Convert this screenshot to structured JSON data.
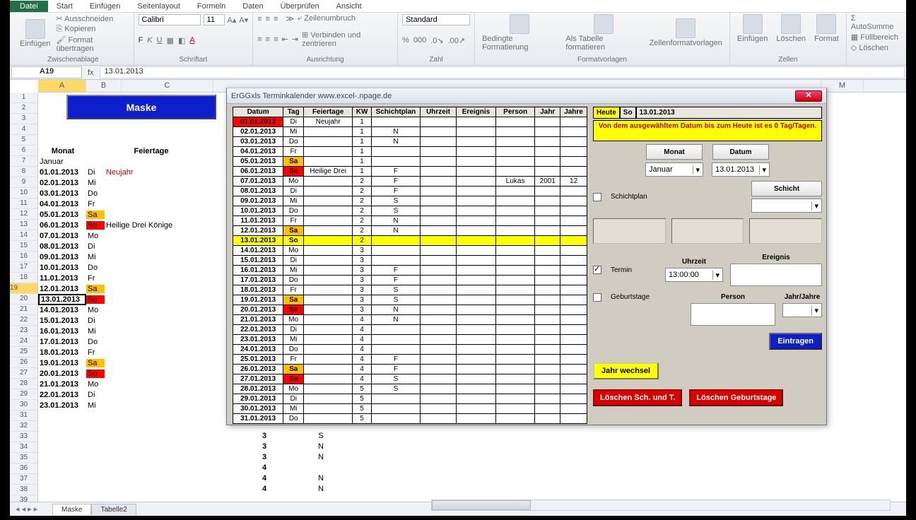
{
  "menu": {
    "file": "Datei",
    "items": [
      "Start",
      "Einfügen",
      "Seitenlayout",
      "Formeln",
      "Daten",
      "Überprüfen",
      "Ansicht"
    ]
  },
  "ribbon": {
    "clipboard": {
      "paste": "Einfügen",
      "cut": "Ausschneiden",
      "copy": "Kopieren",
      "fmt": "Format übertragen",
      "label": "Zwischenablage"
    },
    "font": {
      "name": "Calibri",
      "size": "11",
      "label": "Schriftart"
    },
    "align": {
      "wrap": "Zeilenumbruch",
      "merge": "Verbinden und zentrieren",
      "label": "Ausrichtung"
    },
    "number": {
      "fmt": "Standard",
      "label": "Zahl"
    },
    "styles": {
      "cond": "Bedingte Formatierung",
      "table": "Als Tabelle formatieren",
      "cell": "Zellenformatvorlagen",
      "label": "Formatvorlagen"
    },
    "cells": {
      "ins": "Einfügen",
      "del": "Löschen",
      "fmt": "Format",
      "label": "Zellen"
    },
    "edit": {
      "sum": "AutoSumme",
      "fill": "Füllbereich",
      "clear": "Löschen"
    }
  },
  "namebox": "A19",
  "formula": "13.01.2013",
  "cols": [
    "A",
    "B",
    "C",
    "M"
  ],
  "maske": "Maske",
  "sheet_hdr": {
    "monat": "Monat",
    "feiertage": "Feiertage"
  },
  "month": "Januar",
  "rows": [
    {
      "n": 7,
      "d": "01.01.2013",
      "w": "Di",
      "f": "Neujahr",
      "cls": "nj"
    },
    {
      "n": 8,
      "d": "02.01.2013",
      "w": "Mi"
    },
    {
      "n": 9,
      "d": "03.01.2013",
      "w": "Do"
    },
    {
      "n": 10,
      "d": "04.01.2013",
      "w": "Fr"
    },
    {
      "n": 11,
      "d": "05.01.2013",
      "w": "Sa",
      "wc": "sa"
    },
    {
      "n": 12,
      "d": "06.01.2013",
      "w": "So",
      "wc": "so",
      "f": "Heilige Drei Könige"
    },
    {
      "n": 13,
      "d": "07.01.2013",
      "w": "Mo"
    },
    {
      "n": 14,
      "d": "08.01.2013",
      "w": "Di"
    },
    {
      "n": 15,
      "d": "09.01.2013",
      "w": "Mi"
    },
    {
      "n": 16,
      "d": "10.01.2013",
      "w": "Do"
    },
    {
      "n": 17,
      "d": "11.01.2013",
      "w": "Fr"
    },
    {
      "n": 18,
      "d": "12.01.2013",
      "w": "Sa",
      "wc": "sa"
    },
    {
      "n": 19,
      "d": "13.01.2013",
      "w": "So",
      "wc": "so",
      "sel": true
    },
    {
      "n": 20,
      "d": "14.01.2013",
      "w": "Mo"
    },
    {
      "n": 21,
      "d": "15.01.2013",
      "w": "Di"
    },
    {
      "n": 22,
      "d": "16.01.2013",
      "w": "Mi"
    },
    {
      "n": 23,
      "d": "17.01.2013",
      "w": "Do"
    },
    {
      "n": 24,
      "d": "18.01.2013",
      "w": "Fr"
    },
    {
      "n": 25,
      "d": "19.01.2013",
      "w": "Sa",
      "wc": "sa"
    },
    {
      "n": 26,
      "d": "20.01.2013",
      "w": "So",
      "wc": "so"
    },
    {
      "n": 27,
      "d": "21.01.2013",
      "w": "Mo"
    },
    {
      "n": 28,
      "d": "22.01.2013",
      "w": "Di"
    },
    {
      "n": 29,
      "d": "23.01.2013",
      "w": "Mi"
    }
  ],
  "extra": [
    {
      "k": "3",
      "s": "S"
    },
    {
      "k": "3",
      "s": "N"
    },
    {
      "k": "3",
      "s": "N"
    },
    {
      "k": "4",
      "s": ""
    },
    {
      "k": "4",
      "s": "N"
    },
    {
      "k": "4",
      "s": "N"
    }
  ],
  "dialog": {
    "title": "ErGGxls  Terminkalender       www.excel-.npage.de",
    "headers": [
      "Datum",
      "Tag",
      "Feiertage",
      "KW",
      "Schichtplan",
      "Uhrzeit",
      "Ereignis",
      "Person",
      "Jahr",
      "Jahre"
    ],
    "cal": [
      {
        "d": "01.01.2013",
        "w": "Di",
        "f": "Neujahr",
        "kw": "1",
        "s": "",
        "cls": "r1"
      },
      {
        "d": "02.01.2013",
        "w": "Mi",
        "kw": "1",
        "s": "N"
      },
      {
        "d": "03.01.2013",
        "w": "Do",
        "kw": "1",
        "s": "N"
      },
      {
        "d": "04.01.2013",
        "w": "Fr",
        "kw": "1"
      },
      {
        "d": "05.01.2013",
        "w": "Sa",
        "wc": "sa",
        "kw": "1"
      },
      {
        "d": "06.01.2013",
        "w": "So",
        "wc": "so",
        "f": "Heilige Drei",
        "kw": "1",
        "s": "F"
      },
      {
        "d": "07.01.2013",
        "w": "Mo",
        "kw": "2",
        "s": "F",
        "p": "Lukas",
        "j": "2001",
        "jr": "12"
      },
      {
        "d": "08.01.2013",
        "w": "Di",
        "kw": "2",
        "s": "F"
      },
      {
        "d": "09.01.2013",
        "w": "Mi",
        "kw": "2",
        "s": "S"
      },
      {
        "d": "10.01.2013",
        "w": "Do",
        "kw": "2",
        "s": "S"
      },
      {
        "d": "11.01.2013",
        "w": "Fr",
        "kw": "2",
        "s": "N"
      },
      {
        "d": "12.01.2013",
        "w": "Sa",
        "wc": "sa",
        "kw": "2",
        "s": "N"
      },
      {
        "d": "13.01.2013",
        "w": "So",
        "wc": "so",
        "kw": "2",
        "today": true
      },
      {
        "d": "14.01.2013",
        "w": "Mo",
        "kw": "3"
      },
      {
        "d": "15.01.2013",
        "w": "Di",
        "kw": "3"
      },
      {
        "d": "16.01.2013",
        "w": "Mi",
        "kw": "3",
        "s": "F"
      },
      {
        "d": "17.01.2013",
        "w": "Do",
        "kw": "3",
        "s": "F"
      },
      {
        "d": "18.01.2013",
        "w": "Fr",
        "kw": "3",
        "s": "S"
      },
      {
        "d": "19.01.2013",
        "w": "Sa",
        "wc": "sa",
        "kw": "3",
        "s": "S"
      },
      {
        "d": "20.01.2013",
        "w": "So",
        "wc": "so",
        "kw": "3",
        "s": "N"
      },
      {
        "d": "21.01.2013",
        "w": "Mo",
        "kw": "4",
        "s": "N"
      },
      {
        "d": "22.01.2013",
        "w": "Di",
        "kw": "4"
      },
      {
        "d": "23.01.2013",
        "w": "Mi",
        "kw": "4"
      },
      {
        "d": "24.01.2013",
        "w": "Do",
        "kw": "4"
      },
      {
        "d": "25.01.2013",
        "w": "Fr",
        "kw": "4",
        "s": "F"
      },
      {
        "d": "26.01.2013",
        "w": "Sa",
        "wc": "sa",
        "kw": "4",
        "s": "F"
      },
      {
        "d": "27.01.2013",
        "w": "So",
        "wc": "so",
        "kw": "4",
        "s": "S"
      },
      {
        "d": "28.01.2013",
        "w": "Mo",
        "kw": "5",
        "s": "S"
      },
      {
        "d": "29.01.2013",
        "w": "Di",
        "kw": "5"
      },
      {
        "d": "30.01.2013",
        "w": "Mi",
        "kw": "5"
      },
      {
        "d": "31.01.2013",
        "w": "Do",
        "kw": "5"
      }
    ],
    "heute": {
      "lab": "Heute",
      "w": "So",
      "d": "13.01.2013"
    },
    "msg": "Von dem ausgewähltem Datum bis zum Heute ist es 0 Tag/Tagen.",
    "monat_btn": "Monat",
    "datum_btn": "Datum",
    "monat_val": "Januar",
    "datum_val": "13.01.2013",
    "schichtplan": "Schichtplan",
    "schicht": "Schicht",
    "termin": "Termin",
    "uhrzeit": "Uhrzeit",
    "uhrzeit_val": "13:00:00",
    "ereignis": "Ereignis",
    "geburtstage": "Geburtstage",
    "person": "Person",
    "jahrjahre": "Jahr/Jahre",
    "eintragen": "Eintragen",
    "jahrwechsel": "Jahr wechsel",
    "loeschen1": "Löschen Sch. und T.",
    "loeschen2": "Löschen Geburtstage"
  },
  "tabs": [
    "Maske",
    "Tabelle2"
  ]
}
